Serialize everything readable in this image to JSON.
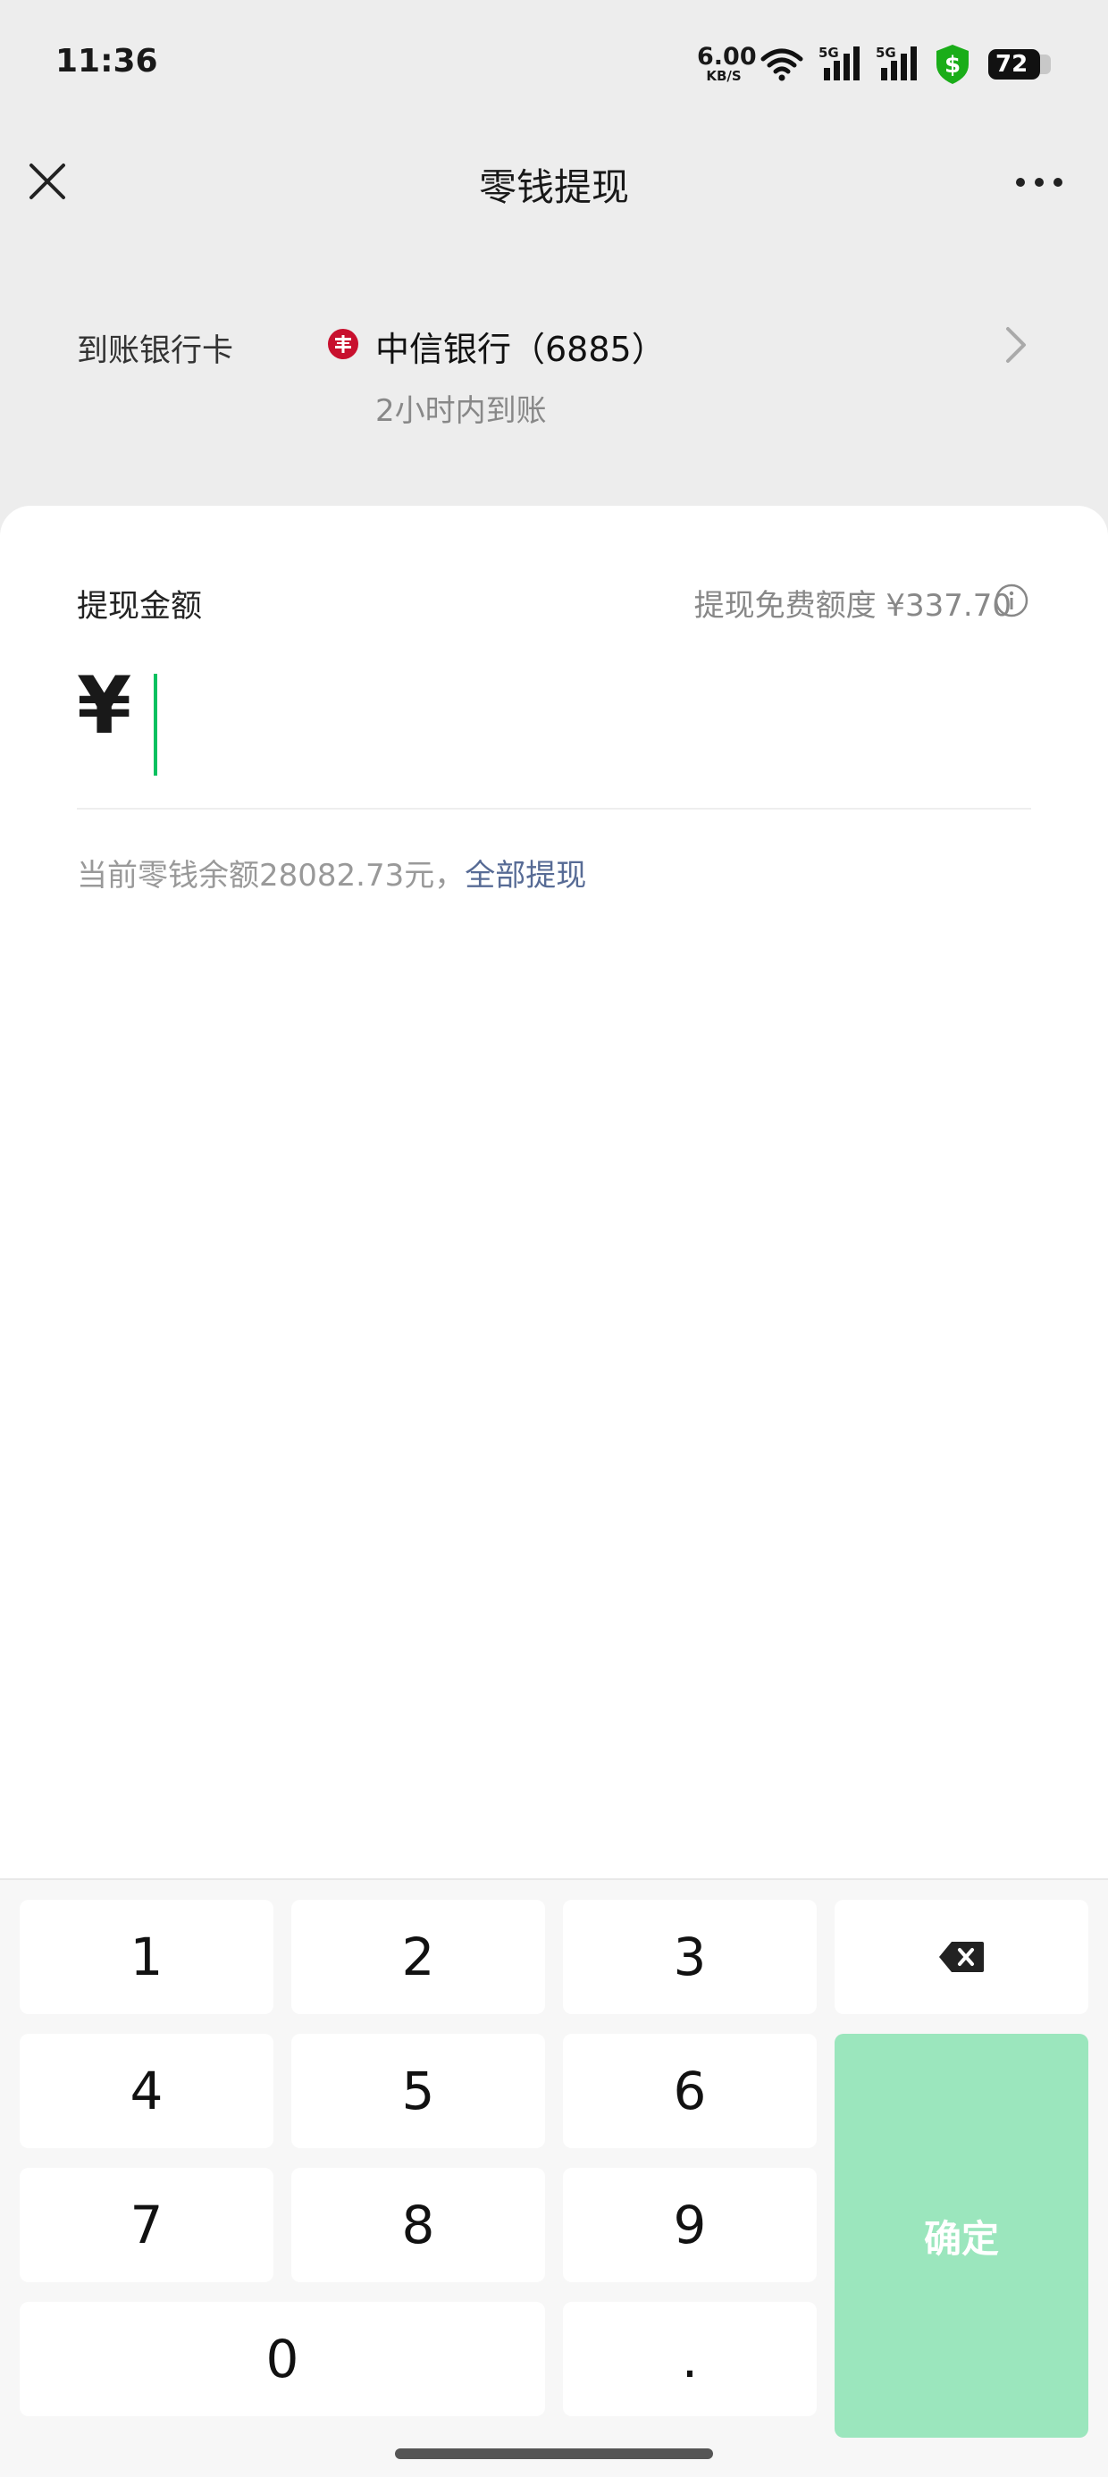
{
  "status_bar": {
    "time": "11:36",
    "net_speed_value": "6.00",
    "net_speed_unit": "KB/S",
    "signal_1_label": "5G",
    "signal_2_label": "5G",
    "battery_level": "72"
  },
  "nav": {
    "title": "零钱提现"
  },
  "bank": {
    "label": "到账银行卡",
    "name": "中信银行（6885）",
    "arrival_time": "2小时内到账",
    "logo_color": "#c8102e"
  },
  "withdraw": {
    "amount_label": "提现金额",
    "free_quota": "提现免费额度 ¥337.70",
    "currency_symbol": "¥",
    "amount_value": "",
    "balance_text": "当前零钱余额28082.73元，",
    "withdraw_all_label": "全部提现",
    "cursor_color": "#07c160"
  },
  "keypad": {
    "keys": [
      "1",
      "2",
      "3",
      "4",
      "5",
      "6",
      "7",
      "8",
      "9",
      "0",
      "."
    ],
    "confirm_label": "确定",
    "confirm_color": "#9be6bd"
  }
}
